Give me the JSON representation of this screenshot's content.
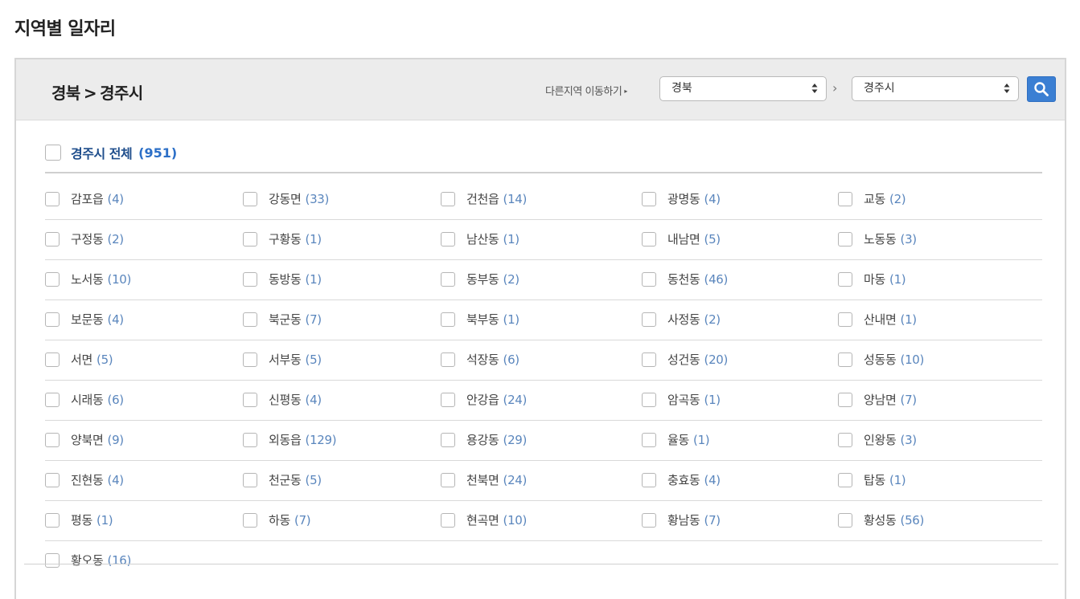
{
  "page": {
    "title": "지역별 일자리"
  },
  "header": {
    "breadcrumb": {
      "province": "경북",
      "separator": ">",
      "city": "경주시"
    },
    "move_label": "다른지역 이동하기",
    "province_select": {
      "value": "경북"
    },
    "chevron": "›",
    "city_select": {
      "value": "경주시"
    },
    "search_icon": "search-icon"
  },
  "all": {
    "label": "경주시 전체",
    "count": "(951)"
  },
  "colors": {
    "accent": "#3b7fd3",
    "count": "#5a86bd",
    "all_label": "#1f4e8c"
  },
  "rows": [
    [
      {
        "name": "감포읍",
        "count": "(4)"
      },
      {
        "name": "강동면",
        "count": "(33)"
      },
      {
        "name": "건천읍",
        "count": "(14)"
      },
      {
        "name": "광명동",
        "count": "(4)"
      },
      {
        "name": "교동",
        "count": "(2)"
      }
    ],
    [
      {
        "name": "구정동",
        "count": "(2)"
      },
      {
        "name": "구황동",
        "count": "(1)"
      },
      {
        "name": "남산동",
        "count": "(1)"
      },
      {
        "name": "내남면",
        "count": "(5)"
      },
      {
        "name": "노동동",
        "count": "(3)"
      }
    ],
    [
      {
        "name": "노서동",
        "count": "(10)"
      },
      {
        "name": "동방동",
        "count": "(1)"
      },
      {
        "name": "동부동",
        "count": "(2)"
      },
      {
        "name": "동천동",
        "count": "(46)"
      },
      {
        "name": "마동",
        "count": "(1)"
      }
    ],
    [
      {
        "name": "보문동",
        "count": "(4)"
      },
      {
        "name": "북군동",
        "count": "(7)"
      },
      {
        "name": "북부동",
        "count": "(1)"
      },
      {
        "name": "사정동",
        "count": "(2)"
      },
      {
        "name": "산내면",
        "count": "(1)"
      }
    ],
    [
      {
        "name": "서면",
        "count": "(5)"
      },
      {
        "name": "서부동",
        "count": "(5)"
      },
      {
        "name": "석장동",
        "count": "(6)"
      },
      {
        "name": "성건동",
        "count": "(20)"
      },
      {
        "name": "성동동",
        "count": "(10)"
      }
    ],
    [
      {
        "name": "시래동",
        "count": "(6)"
      },
      {
        "name": "신평동",
        "count": "(4)"
      },
      {
        "name": "안강읍",
        "count": "(24)"
      },
      {
        "name": "암곡동",
        "count": "(1)"
      },
      {
        "name": "양남면",
        "count": "(7)"
      }
    ],
    [
      {
        "name": "양북면",
        "count": "(9)"
      },
      {
        "name": "외동읍",
        "count": "(129)"
      },
      {
        "name": "용강동",
        "count": "(29)"
      },
      {
        "name": "율동",
        "count": "(1)"
      },
      {
        "name": "인왕동",
        "count": "(3)"
      }
    ],
    [
      {
        "name": "진현동",
        "count": "(4)"
      },
      {
        "name": "천군동",
        "count": "(5)"
      },
      {
        "name": "천북면",
        "count": "(24)"
      },
      {
        "name": "충효동",
        "count": "(4)"
      },
      {
        "name": "탑동",
        "count": "(1)"
      }
    ],
    [
      {
        "name": "평동",
        "count": "(1)"
      },
      {
        "name": "하동",
        "count": "(7)"
      },
      {
        "name": "현곡면",
        "count": "(10)"
      },
      {
        "name": "황남동",
        "count": "(7)"
      },
      {
        "name": "황성동",
        "count": "(56)"
      }
    ],
    [
      {
        "name": "황오동",
        "count": "(16)"
      }
    ]
  ]
}
